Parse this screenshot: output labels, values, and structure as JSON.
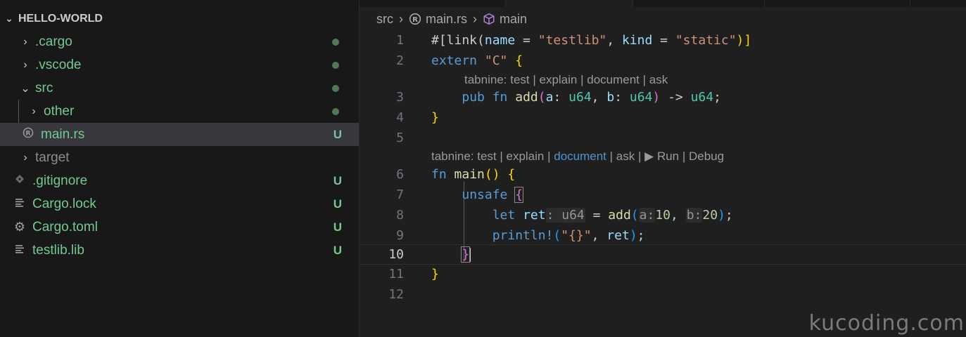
{
  "explorer": {
    "title": "HELLO-WORLD",
    "items": [
      {
        "label": ".cargo",
        "status": "dot",
        "twist": "›"
      },
      {
        "label": ".vscode",
        "status": "dot",
        "twist": "›"
      },
      {
        "label": "src",
        "status": "dot",
        "twist": "⌄"
      },
      {
        "label": "other",
        "status": "dot",
        "twist": "›"
      },
      {
        "label": "main.rs",
        "status": "U"
      },
      {
        "label": "target",
        "twist": "›"
      },
      {
        "label": ".gitignore",
        "status": "U"
      },
      {
        "label": "Cargo.lock",
        "status": "U"
      },
      {
        "label": "Cargo.toml",
        "status": "U"
      },
      {
        "label": "testlib.lib",
        "status": "U"
      }
    ]
  },
  "breadcrumb": {
    "folder": "src",
    "file": "main.rs",
    "symbol": "main"
  },
  "editor": {
    "line_numbers": [
      "1",
      "2",
      "3",
      "4",
      "5",
      "6",
      "7",
      "8",
      "9",
      "10",
      "11",
      "12"
    ],
    "code": {
      "l1_attr_open": "#[link(",
      "l1_name": "name",
      "l1_eq1": " = ",
      "l1_str1": "\"testlib\"",
      "l1_comma": ", ",
      "l1_kind": "kind",
      "l1_eq2": " = ",
      "l1_str2": "\"static\"",
      "l1_close": ")]",
      "l2_extern": "extern",
      "l2_str": "\"C\"",
      "l2_brace": "{",
      "l3_pub": "pub",
      "l3_fn": "fn",
      "l3_name": "add",
      "l3_params": [
        "a",
        "u64",
        "b",
        "u64"
      ],
      "l3_ret": "u64",
      "l4_brace": "}",
      "l6_fn": "fn",
      "l6_name": "main",
      "l6_parens": "()",
      "l6_brace": "{",
      "l7_unsafe": "unsafe",
      "l7_brace": "{",
      "l8_let": "let",
      "l8_var": "ret",
      "l8_hint": ": u64",
      "l8_call": "add",
      "l8_hint_a": "a:",
      "l8_arg1": "10",
      "l8_hint_b": "b:",
      "l8_arg2": "20",
      "l9_macro": "println!",
      "l9_str": "\"{}\"",
      "l9_var": "ret",
      "l10_brace": "}",
      "l11_brace": "}"
    },
    "lens1": {
      "items": [
        "tabnine: test",
        "explain",
        "document",
        "ask"
      ]
    },
    "lens2": {
      "items": [
        "tabnine: test",
        "explain",
        "document",
        "ask",
        "▶ Run",
        "Debug"
      ]
    },
    "current_line": "10"
  },
  "watermark": "kucoding.com",
  "colors": {
    "untracked": "#73c991",
    "keyword": "#569cd6",
    "string": "#ce9178",
    "function": "#dcdcaa",
    "type": "#4ec9b0",
    "bracket_gold": "#ffd700",
    "bracket_purple": "#da70d6"
  }
}
